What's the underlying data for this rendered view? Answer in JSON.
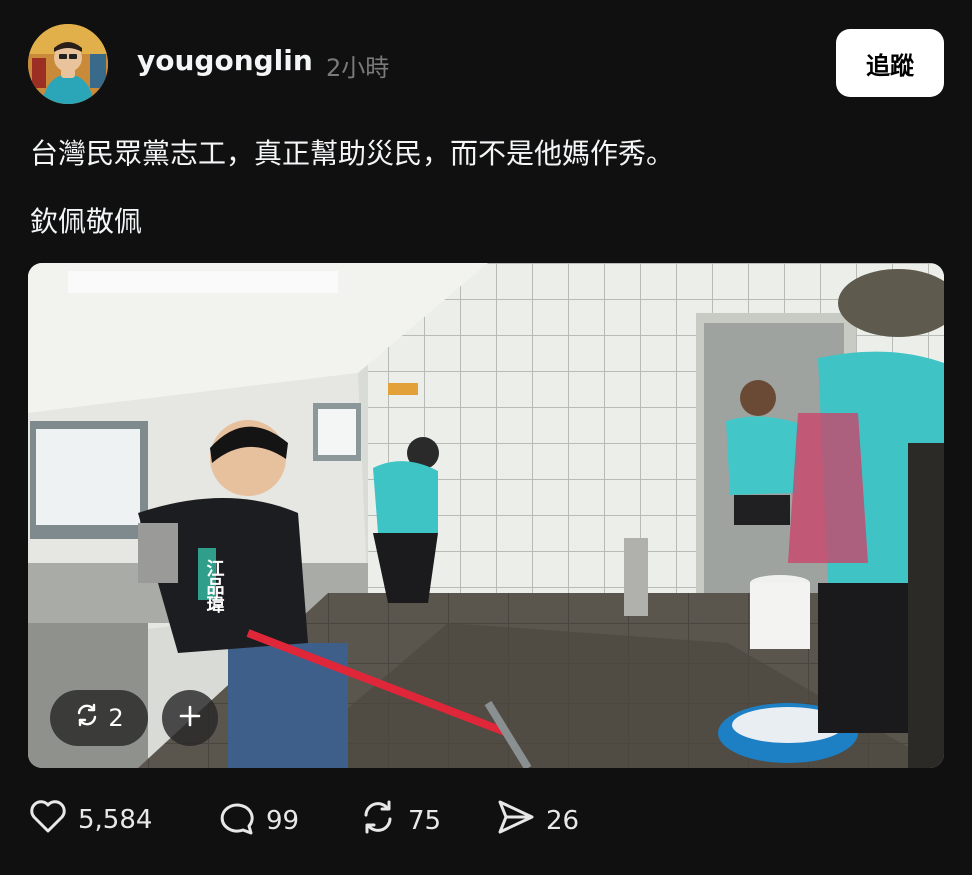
{
  "post": {
    "username": "yougonglin",
    "time": "2小時",
    "follow_label": "追蹤",
    "text_line1": "台灣民眾黨志工，真正幫助災民，而不是他媽作秀。",
    "text_line2": "欽佩敬佩",
    "media_overlay": {
      "repost_count": "2",
      "repost_icon": "repost-icon",
      "add_icon": "plus-icon",
      "vest_text": "江品瑋"
    },
    "stats": {
      "likes": "5,584",
      "replies": "99",
      "reposts": "75",
      "shares": "26"
    }
  },
  "colors": {
    "background": "#101010",
    "text": "#f3f5f7",
    "muted": "#7a7a7a",
    "follow_bg": "#ffffff"
  }
}
